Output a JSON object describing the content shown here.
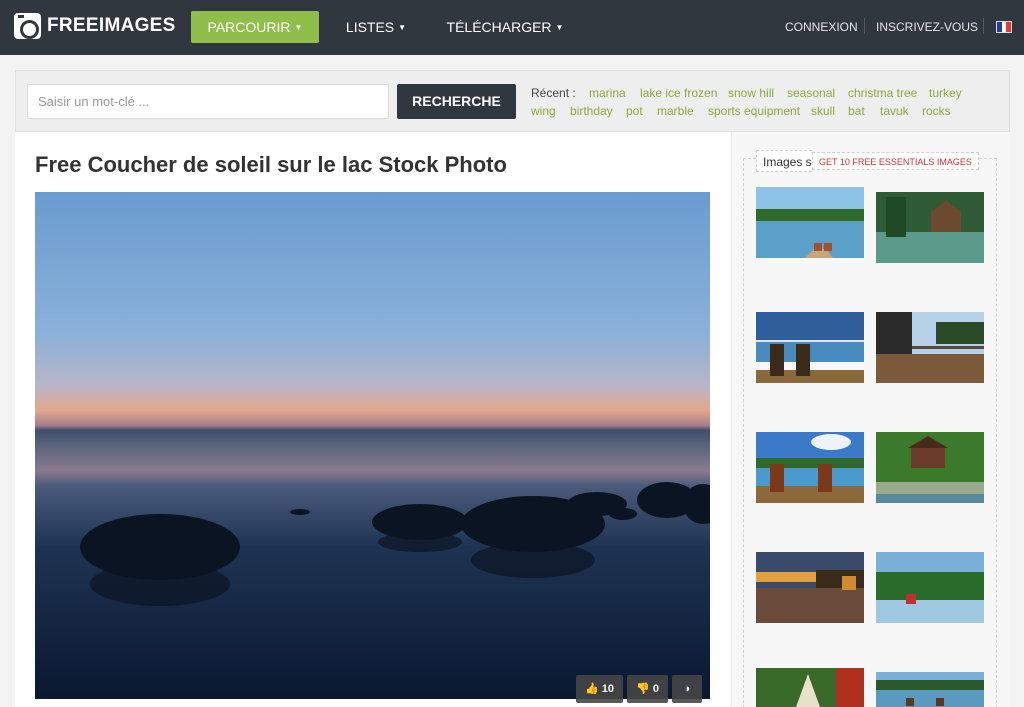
{
  "header": {
    "logo_text": "FREEIMAGES",
    "nav": [
      {
        "label": "PARCOURIR"
      },
      {
        "label": "LISTES"
      },
      {
        "label": "TÉLÉCHARGER"
      }
    ],
    "login": "CONNEXION",
    "register": "INSCRIVEZ-VOUS",
    "language_flag": "flag-france-icon"
  },
  "search": {
    "placeholder": "Saisir un mot-clé ...",
    "button": "RECHERCHE",
    "recent_label": "Récent :",
    "recent_tags": [
      "marina",
      "lake ice frozen",
      "snow hill",
      "seasonal",
      "christma tree",
      "turkey",
      "wing",
      "birthday",
      "pot",
      "marble",
      "sports equipment",
      "skull",
      "bat",
      "tavuk",
      "rocks"
    ]
  },
  "photo": {
    "title": "Free Coucher de soleil sur le lac Stock Photo",
    "likes": "10",
    "dislikes": "0"
  },
  "sidebar": {
    "similar_title": "Images similaires",
    "promo": "GET 10 FREE ESSENTIALS IMAGES"
  },
  "colors": {
    "nav_bg": "#31373f",
    "accent_green": "#8fbe4a",
    "tag_green": "#8aaa3f",
    "promo_red": "#d0312d"
  }
}
